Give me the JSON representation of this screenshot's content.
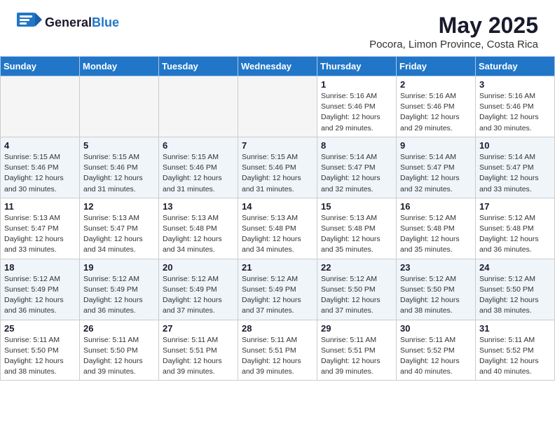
{
  "header": {
    "logo_general": "General",
    "logo_blue": "Blue",
    "month_title": "May 2025",
    "subtitle": "Pocora, Limon Province, Costa Rica"
  },
  "days_of_week": [
    "Sunday",
    "Monday",
    "Tuesday",
    "Wednesday",
    "Thursday",
    "Friday",
    "Saturday"
  ],
  "weeks": [
    [
      {
        "day": "",
        "info": ""
      },
      {
        "day": "",
        "info": ""
      },
      {
        "day": "",
        "info": ""
      },
      {
        "day": "",
        "info": ""
      },
      {
        "day": "1",
        "info": "Sunrise: 5:16 AM\nSunset: 5:46 PM\nDaylight: 12 hours\nand 29 minutes."
      },
      {
        "day": "2",
        "info": "Sunrise: 5:16 AM\nSunset: 5:46 PM\nDaylight: 12 hours\nand 29 minutes."
      },
      {
        "day": "3",
        "info": "Sunrise: 5:16 AM\nSunset: 5:46 PM\nDaylight: 12 hours\nand 30 minutes."
      }
    ],
    [
      {
        "day": "4",
        "info": "Sunrise: 5:15 AM\nSunset: 5:46 PM\nDaylight: 12 hours\nand 30 minutes."
      },
      {
        "day": "5",
        "info": "Sunrise: 5:15 AM\nSunset: 5:46 PM\nDaylight: 12 hours\nand 31 minutes."
      },
      {
        "day": "6",
        "info": "Sunrise: 5:15 AM\nSunset: 5:46 PM\nDaylight: 12 hours\nand 31 minutes."
      },
      {
        "day": "7",
        "info": "Sunrise: 5:15 AM\nSunset: 5:46 PM\nDaylight: 12 hours\nand 31 minutes."
      },
      {
        "day": "8",
        "info": "Sunrise: 5:14 AM\nSunset: 5:47 PM\nDaylight: 12 hours\nand 32 minutes."
      },
      {
        "day": "9",
        "info": "Sunrise: 5:14 AM\nSunset: 5:47 PM\nDaylight: 12 hours\nand 32 minutes."
      },
      {
        "day": "10",
        "info": "Sunrise: 5:14 AM\nSunset: 5:47 PM\nDaylight: 12 hours\nand 33 minutes."
      }
    ],
    [
      {
        "day": "11",
        "info": "Sunrise: 5:13 AM\nSunset: 5:47 PM\nDaylight: 12 hours\nand 33 minutes."
      },
      {
        "day": "12",
        "info": "Sunrise: 5:13 AM\nSunset: 5:47 PM\nDaylight: 12 hours\nand 34 minutes."
      },
      {
        "day": "13",
        "info": "Sunrise: 5:13 AM\nSunset: 5:48 PM\nDaylight: 12 hours\nand 34 minutes."
      },
      {
        "day": "14",
        "info": "Sunrise: 5:13 AM\nSunset: 5:48 PM\nDaylight: 12 hours\nand 34 minutes."
      },
      {
        "day": "15",
        "info": "Sunrise: 5:13 AM\nSunset: 5:48 PM\nDaylight: 12 hours\nand 35 minutes."
      },
      {
        "day": "16",
        "info": "Sunrise: 5:12 AM\nSunset: 5:48 PM\nDaylight: 12 hours\nand 35 minutes."
      },
      {
        "day": "17",
        "info": "Sunrise: 5:12 AM\nSunset: 5:48 PM\nDaylight: 12 hours\nand 36 minutes."
      }
    ],
    [
      {
        "day": "18",
        "info": "Sunrise: 5:12 AM\nSunset: 5:49 PM\nDaylight: 12 hours\nand 36 minutes."
      },
      {
        "day": "19",
        "info": "Sunrise: 5:12 AM\nSunset: 5:49 PM\nDaylight: 12 hours\nand 36 minutes."
      },
      {
        "day": "20",
        "info": "Sunrise: 5:12 AM\nSunset: 5:49 PM\nDaylight: 12 hours\nand 37 minutes."
      },
      {
        "day": "21",
        "info": "Sunrise: 5:12 AM\nSunset: 5:49 PM\nDaylight: 12 hours\nand 37 minutes."
      },
      {
        "day": "22",
        "info": "Sunrise: 5:12 AM\nSunset: 5:50 PM\nDaylight: 12 hours\nand 37 minutes."
      },
      {
        "day": "23",
        "info": "Sunrise: 5:12 AM\nSunset: 5:50 PM\nDaylight: 12 hours\nand 38 minutes."
      },
      {
        "day": "24",
        "info": "Sunrise: 5:12 AM\nSunset: 5:50 PM\nDaylight: 12 hours\nand 38 minutes."
      }
    ],
    [
      {
        "day": "25",
        "info": "Sunrise: 5:11 AM\nSunset: 5:50 PM\nDaylight: 12 hours\nand 38 minutes."
      },
      {
        "day": "26",
        "info": "Sunrise: 5:11 AM\nSunset: 5:50 PM\nDaylight: 12 hours\nand 39 minutes."
      },
      {
        "day": "27",
        "info": "Sunrise: 5:11 AM\nSunset: 5:51 PM\nDaylight: 12 hours\nand 39 minutes."
      },
      {
        "day": "28",
        "info": "Sunrise: 5:11 AM\nSunset: 5:51 PM\nDaylight: 12 hours\nand 39 minutes."
      },
      {
        "day": "29",
        "info": "Sunrise: 5:11 AM\nSunset: 5:51 PM\nDaylight: 12 hours\nand 39 minutes."
      },
      {
        "day": "30",
        "info": "Sunrise: 5:11 AM\nSunset: 5:52 PM\nDaylight: 12 hours\nand 40 minutes."
      },
      {
        "day": "31",
        "info": "Sunrise: 5:11 AM\nSunset: 5:52 PM\nDaylight: 12 hours\nand 40 minutes."
      }
    ]
  ]
}
